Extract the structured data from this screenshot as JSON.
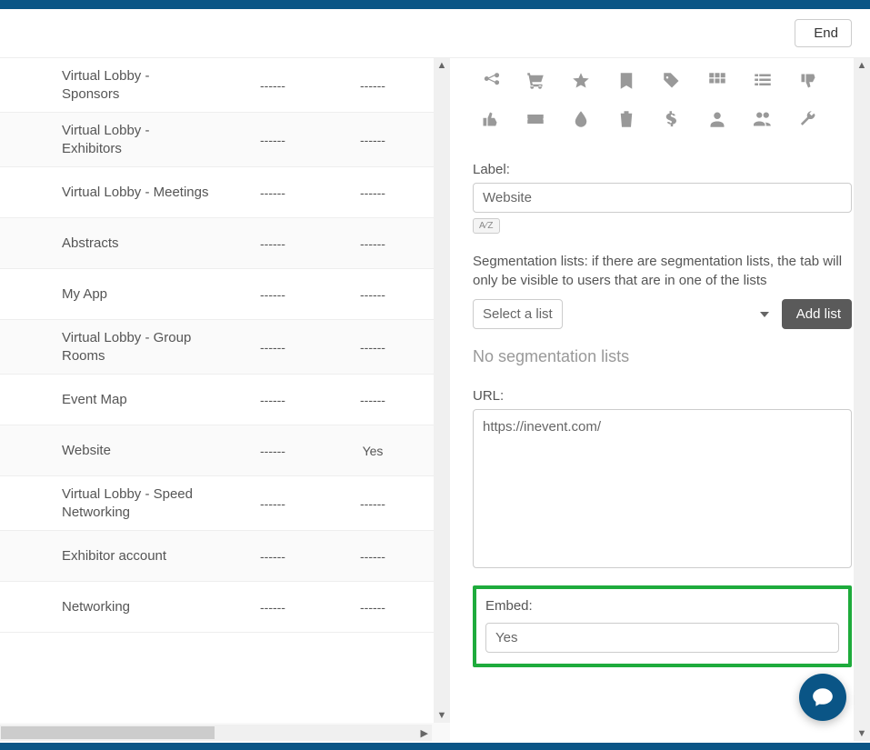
{
  "header": {
    "end_label": "End"
  },
  "table": {
    "rows": [
      {
        "name": "Virtual Lobby - Sponsors",
        "c2": "------",
        "c3": "------"
      },
      {
        "name": "Virtual Lobby - Exhibitors",
        "c2": "------",
        "c3": "------"
      },
      {
        "name": "Virtual Lobby - Meetings",
        "c2": "------",
        "c3": "------"
      },
      {
        "name": "Abstracts",
        "c2": "------",
        "c3": "------"
      },
      {
        "name": "My App",
        "c2": "------",
        "c3": "------"
      },
      {
        "name": "Virtual Lobby - Group Rooms",
        "c2": "------",
        "c3": "------"
      },
      {
        "name": "Event Map",
        "c2": "------",
        "c3": "------"
      },
      {
        "name": "Website",
        "c2": "------",
        "c3": "Yes"
      },
      {
        "name": "Virtual Lobby - Speed Networking",
        "c2": "------",
        "c3": "------"
      },
      {
        "name": "Exhibitor account",
        "c2": "------",
        "c3": "------"
      },
      {
        "name": "Networking",
        "c2": "------",
        "c3": "------"
      }
    ]
  },
  "form": {
    "label_field": "Label:",
    "label_value": "Website",
    "lang_badge": "A⁄Z",
    "segmentation_desc": "Segmentation lists: if there are segmentation lists, the tab will only be visible to users that are in one of the lists",
    "select_placeholder": "Select a list",
    "add_list_label": "Add list",
    "no_lists_text": "No segmentation lists",
    "url_label": "URL:",
    "url_value": "https://inevent.com/",
    "embed_label": "Embed:",
    "embed_value": "Yes"
  },
  "icons": {
    "row1": [
      "share-icon",
      "cart-icon",
      "star-icon",
      "bookmark-icon",
      "tags-icon",
      "grid-icon",
      "list-icon",
      "thumbs-down-icon",
      "thumbs-up-icon"
    ],
    "row2": [
      "ticket-icon",
      "tint-icon",
      "trash-icon",
      "dollar-icon",
      "user-icon",
      "users-icon",
      "wrench-icon"
    ]
  }
}
